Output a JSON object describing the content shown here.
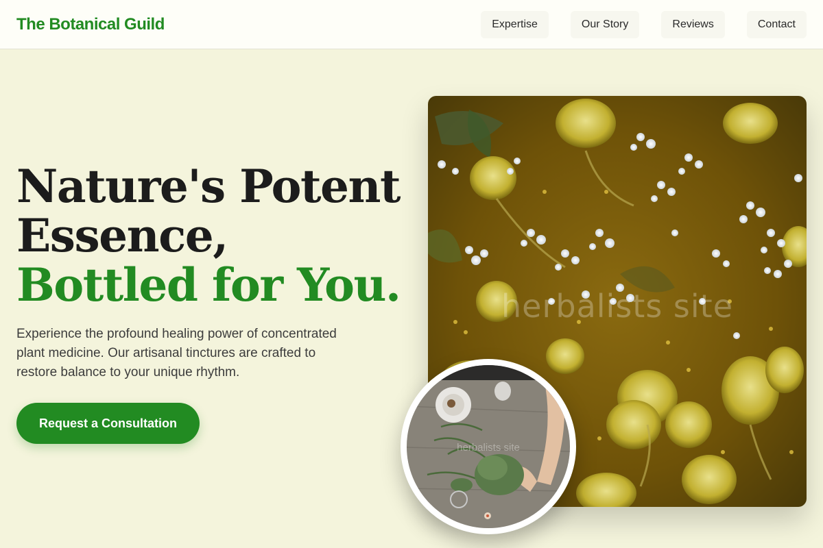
{
  "brand": {
    "name": "The Botanical Guild",
    "color": "#228b22"
  },
  "nav": {
    "items": [
      {
        "label": "Expertise"
      },
      {
        "label": "Our Story"
      },
      {
        "label": "Reviews"
      },
      {
        "label": "Contact"
      }
    ]
  },
  "hero": {
    "title_line1": "Nature's Potent",
    "title_line2": "Essence,",
    "title_accent": "Bottled for You.",
    "subtitle": "Experience the profound healing power of concentrated plant medicine. Our artisanal tinctures are crafted to restore balance to your unique rhythm.",
    "cta_label": "Request a Consultation"
  },
  "images": {
    "main": {
      "icon": "herbal-infusion-photo",
      "watermark": "herbalists site"
    },
    "circle": {
      "icon": "herb-preparation-photo",
      "watermark": "herbalists site"
    }
  },
  "colors": {
    "background": "#f4f4dc",
    "accent": "#228b22",
    "header_bg": "#fefef8"
  }
}
